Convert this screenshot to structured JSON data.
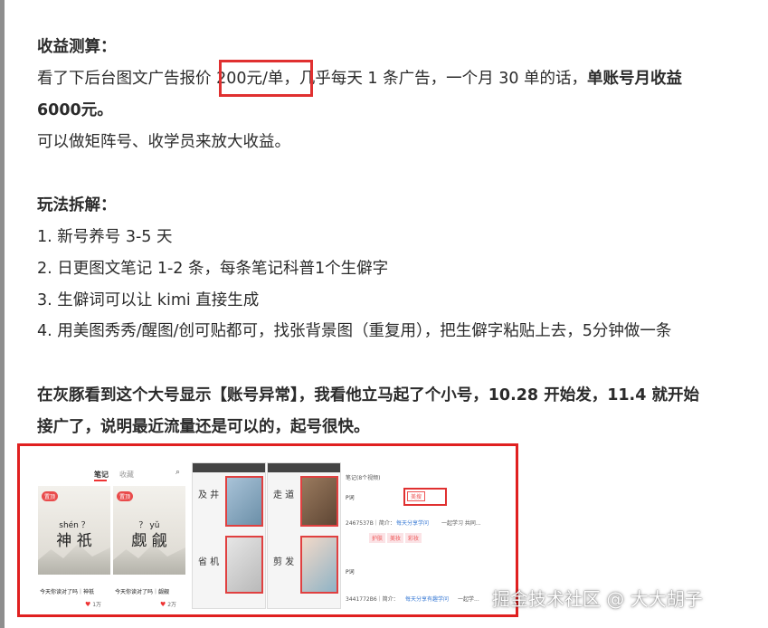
{
  "article": {
    "income_heading": "收益测算：",
    "income_line1_a": "看了下后台图文广告报价 ",
    "income_line1_price": "200元/单",
    "income_line1_b": "，几乎每天 1 条广告，一个月 30 单的话，",
    "income_line1_bold": "单账号月收益",
    "income_line2_bold": "6000元。",
    "income_line3": "可以做矩阵号、收学员来放大收益。",
    "play_heading": "玩法拆解：",
    "steps": [
      "1. 新号养号 3-5 天",
      "2. 日更图文笔记 1-2 条，每条笔记科普1个生僻字",
      "3. 生僻词可以让 kimi 直接生成",
      "4. 用美图秀秀/醒图/创可贴都可，找张背景图（重复用），把生僻字粘贴上去，5分钟做一条"
    ],
    "bold_para_line1": "在灰豚看到这个大号显示【账号异常】，我看他立马起了个小号，10.28 开始发，11.4 就开始",
    "bold_para_line2": "接广了，说明最近流量还是可以的，起号很快。"
  },
  "screenshot": {
    "tab_notes": "笔记",
    "tab_collect": "收藏",
    "search_icon": "search-icon",
    "card1": {
      "tag": "置顶",
      "pinyin": "shén  ？",
      "hanzi": "神 祇",
      "caption": "今天你读对了吗｜神祇",
      "likes": "1万"
    },
    "card2": {
      "tag": "置顶",
      "pinyin": "？   yǔ",
      "hanzi": "觑 觎",
      "caption": "今天你读对了吗｜觑觎",
      "likes": "2万"
    },
    "phone1_words": [
      "及 井",
      "省 机"
    ],
    "phone2_words": [
      "走 道",
      "剪 发"
    ],
    "right_top": "笔记(8个视频)",
    "right_badge": "美搜",
    "right_tags": [
      "护肤",
      "美妆",
      "彩妆"
    ],
    "right_row1": "2467537B｜简介：",
    "right_row2": "3441772B6｜简介：",
    "right_share": "每天分享学问",
    "right_share2": "每天分享有趣学问",
    "right_link": "一起学习 共同...",
    "right_link2": "一起学..."
  },
  "watermark": "掘金技术社区 @ 大大胡子",
  "colors": {
    "highlight_red": "#e03030",
    "text": "#2b2b2b",
    "left_bar": "#8e8e8e"
  }
}
